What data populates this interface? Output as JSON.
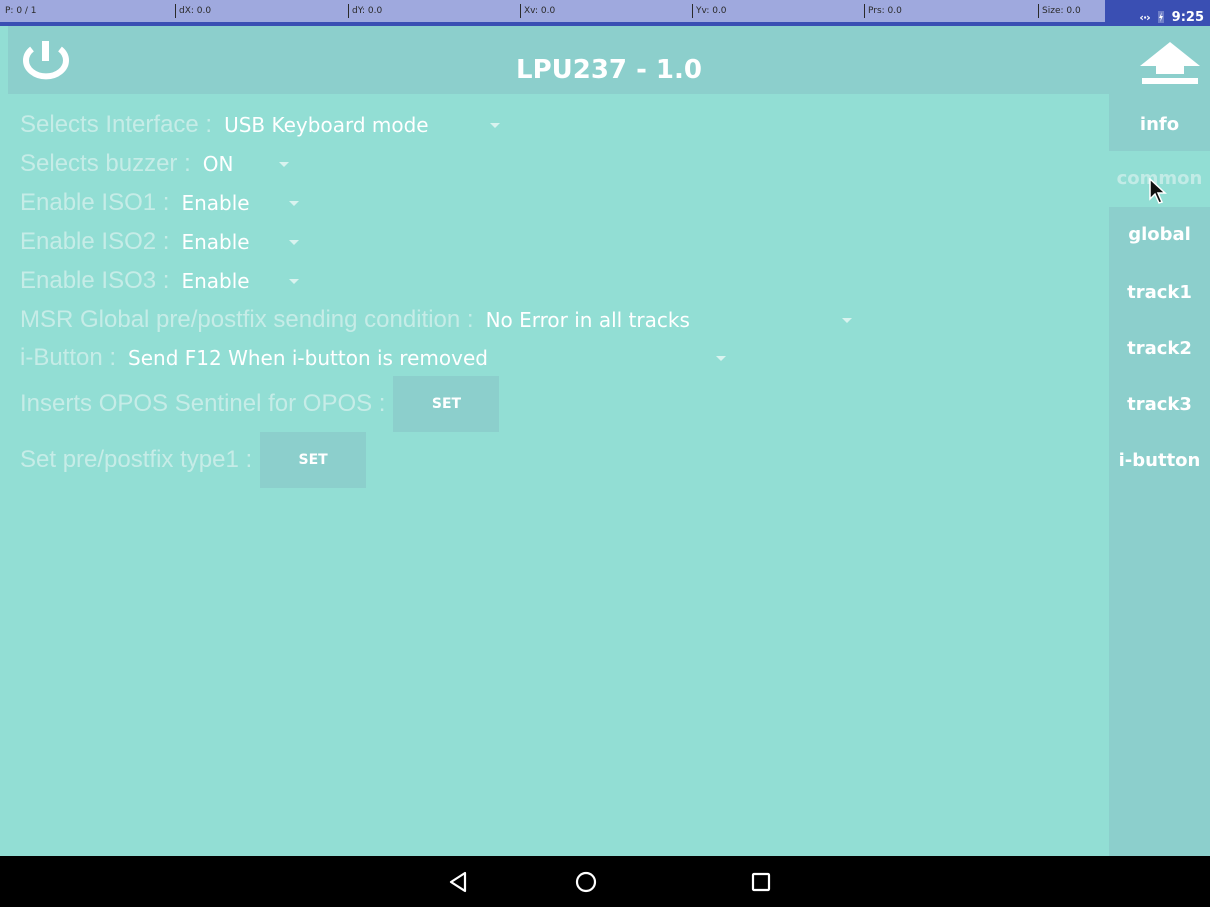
{
  "pointer_bar": {
    "p": "P: 0 / 1",
    "dx": "dX: 0.0",
    "dy": "dY: 0.0",
    "xv": "Xv: 0.0",
    "yv": "Yv: 0.0",
    "prs": "Prs: 0.0",
    "size": "Size: 0.0"
  },
  "status_bar": {
    "time": "9:25",
    "icons": [
      "data-arrows-icon",
      "charging-battery-icon"
    ]
  },
  "toolbar": {
    "title": "LPU237 - 1.0",
    "left_icon": "power-icon",
    "right_icon": "upload-arrow-icon"
  },
  "settings": [
    {
      "label": "Selects Interface : ",
      "value": "USB Keyboard mode"
    },
    {
      "label": "Selects buzzer : ",
      "value": "ON"
    },
    {
      "label": "Enable ISO1 : ",
      "value": "Enable"
    },
    {
      "label": "Enable ISO2 : ",
      "value": "Enable"
    },
    {
      "label": "Enable ISO3 : ",
      "value": "Enable"
    },
    {
      "label": "MSR Global pre/postfix sending condition : ",
      "value": "No Error in all tracks"
    },
    {
      "label": "i-Button : ",
      "value": "Send F12 When i-button is removed"
    }
  ],
  "buttons": [
    {
      "label": "Inserts OPOS Sentinel for OPOS : ",
      "button": "SET"
    },
    {
      "label": "Set pre/postfix type1 : ",
      "button": "SET"
    }
  ],
  "tabs": [
    {
      "label": "info",
      "selected": false
    },
    {
      "label": "common",
      "selected": true
    },
    {
      "label": "global",
      "selected": false
    },
    {
      "label": "track1",
      "selected": false
    },
    {
      "label": "track2",
      "selected": false
    },
    {
      "label": "track3",
      "selected": false
    },
    {
      "label": "i-button",
      "selected": false
    }
  ],
  "navbar": {
    "icons": [
      "back-icon",
      "home-icon",
      "recents-icon"
    ]
  },
  "colors": {
    "content_bg": "#92ded4",
    "toolbar_bg": "#8ccfcc",
    "label_text": "#c6ece7",
    "value_text": "#ffffff",
    "pointer_bar_dark": "#3a4fb3",
    "pointer_bar_light": "#9fa9de"
  }
}
